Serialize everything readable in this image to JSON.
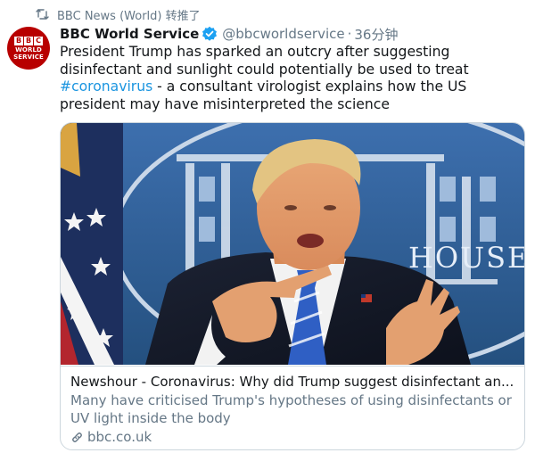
{
  "retweet": {
    "icon": "retweet-icon",
    "text": "BBC News (World) 转推了"
  },
  "author": {
    "avatar_icon": "bbc-world-service-logo",
    "avatar_letters": [
      "B",
      "B",
      "C"
    ],
    "avatar_line1": "WORLD",
    "avatar_line2": "SERVICE",
    "display_name": "BBC World Service",
    "verified_icon": "verified-badge-icon",
    "handle": "@bbcworldservice",
    "separator": "·",
    "time": "36分钟"
  },
  "tweet": {
    "text_before": "President Trump has sparked an outcry after suggesting disinfectant and sunlight could potentially be used to treat ",
    "hashtag": "#coronavirus",
    "text_after": " - a consultant virologist explains how the US president may have misinterpreted the science"
  },
  "card": {
    "image_sign_text": "HOUSE",
    "title": "Newshour - Coronavirus: Why did Trump suggest disinfectant an...",
    "description": "Many have criticised Trump's hypotheses of using disinfectants or UV light inside the body",
    "link_icon": "link-icon",
    "domain": "bbc.co.uk"
  },
  "colors": {
    "link_blue": "#1b95e0",
    "secondary_text": "#657786",
    "bbc_red": "#b80000",
    "briefing_room_blue": "#2f5f9c"
  }
}
